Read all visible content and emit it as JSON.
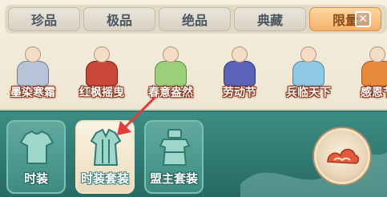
{
  "tabs": [
    {
      "label": "珍品",
      "active": false
    },
    {
      "label": "极品",
      "active": false
    },
    {
      "label": "绝品",
      "active": false
    },
    {
      "label": "典藏",
      "active": false
    },
    {
      "label": "限量",
      "active": true
    }
  ],
  "costumes": [
    {
      "name": "墨染寒霜",
      "icon": "silver-armor-costume-icon",
      "color": "#b7c3d6"
    },
    {
      "name": "红枫摇曳",
      "icon": "red-maple-costume-icon",
      "color": "#c9463b"
    },
    {
      "name": "春意盎然",
      "icon": "spring-green-costume-icon",
      "color": "#9bcf7a"
    },
    {
      "name": "劳动节",
      "icon": "labor-day-costume-icon",
      "color": "#5a63b8"
    },
    {
      "name": "兵临天下",
      "icon": "ice-warrior-costume-icon",
      "color": "#8fc9e6"
    },
    {
      "name": "感恩节",
      "icon": "thanksgiving-costume-icon",
      "color": "#e88a3c"
    }
  ],
  "categories": [
    {
      "label": "时装",
      "icon": "shirt-icon",
      "selected": false
    },
    {
      "label": "时装套装",
      "icon": "robe-icon",
      "selected": true
    },
    {
      "label": "盟主套装",
      "icon": "leader-robe-icon",
      "selected": false
    }
  ],
  "colors": {
    "accent_orange": "#f6b06c",
    "teal_bar": "#2f7a73",
    "annotation_arrow": "#e23b3b"
  }
}
